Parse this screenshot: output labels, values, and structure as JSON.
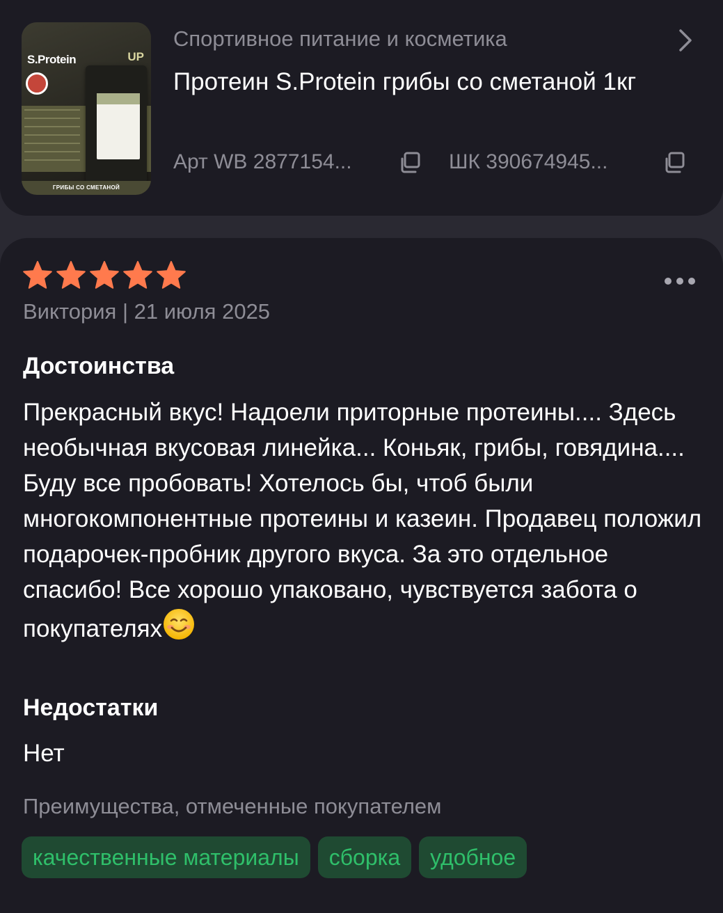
{
  "product": {
    "category": "Спортивное питание и косметика",
    "title": "Протеин S.Protein грибы со сметаной 1кг",
    "article": "Арт WB 2877154...",
    "barcode": "ШК 390674945...",
    "image": {
      "brand": "S.Protein",
      "badge": "UP",
      "caption": "ГРИБЫ СО СМЕТАНОЙ"
    }
  },
  "review": {
    "rating": 5,
    "rating_max": 5,
    "star_color": "#ff7a4d",
    "author_date": "Виктория | 21 июля 2025",
    "pros_title": "Достоинства",
    "pros_text": "Прекрасный вкус! Надоели приторные протеины.... Здесь необычная вкусовая линейка... Коньяк, грибы, говядина.... Буду все пробовать! Хотелось бы, чтоб были многокомпонентные протеины и казеин. Продавец положил подарочек-пробник другого вкуса. За это отдельное спасибо! Все хорошо упаковано, чувствуется забота о покупателях",
    "pros_emoji": "smiling-face-icon",
    "cons_title": "Недостатки",
    "cons_text": "Нет",
    "advantages_title": "Преимущества, отмеченные покупателем",
    "advantages": [
      "качественные материалы",
      "сборка",
      "удобное"
    ],
    "tag_color": "#2fbf6a"
  },
  "icons": {
    "chevron": "chevron-right-icon",
    "copy": "copy-icon",
    "more": "more-dots-icon"
  }
}
